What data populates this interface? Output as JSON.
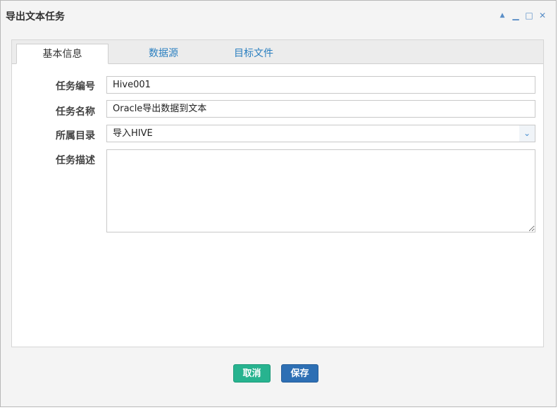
{
  "window": {
    "title": "导出文本任务",
    "controls": {
      "collapse": "▲",
      "minimize": "▁",
      "maximize": "□",
      "close": "✕"
    }
  },
  "tabs": [
    {
      "label": "基本信息",
      "active": true
    },
    {
      "label": "数据源",
      "active": false
    },
    {
      "label": "目标文件",
      "active": false
    }
  ],
  "form": {
    "task_id": {
      "label": "任务编号",
      "value": "Hive001"
    },
    "task_name": {
      "label": "任务名称",
      "value": "Oracle导出数据到文本"
    },
    "directory": {
      "label": "所属目录",
      "value": "导入HIVE"
    },
    "description": {
      "label": "任务描述",
      "value": ""
    }
  },
  "buttons": {
    "cancel": "取消",
    "save": "保存"
  },
  "colors": {
    "accent": "#2a7fc0",
    "cancel": "#27b38f",
    "save": "#2d6fb4"
  }
}
